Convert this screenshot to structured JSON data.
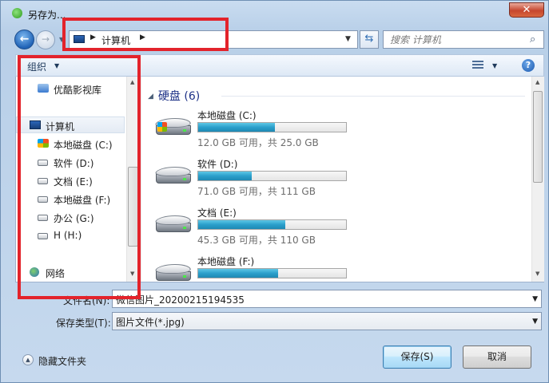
{
  "window": {
    "title": "另存为..."
  },
  "nav": {
    "breadcrumb": "计算机",
    "search_placeholder": "搜索 计算机"
  },
  "toolbar": {
    "organize": "组织"
  },
  "navpane": {
    "items": [
      {
        "label": "优酷影视库",
        "icon": "folder-icon"
      },
      {
        "label": "计算机",
        "icon": "computer-icon"
      },
      {
        "label": "本地磁盘 (C:)",
        "icon": "windows-drive-icon"
      },
      {
        "label": "软件 (D:)",
        "icon": "drive-icon"
      },
      {
        "label": "文档 (E:)",
        "icon": "drive-icon"
      },
      {
        "label": "本地磁盘 (F:)",
        "icon": "drive-icon"
      },
      {
        "label": "办公 (G:)",
        "icon": "drive-icon"
      },
      {
        "label": "H (H:)",
        "icon": "drive-icon"
      },
      {
        "label": "网络",
        "icon": "network-icon"
      }
    ]
  },
  "main": {
    "group_title": "硬盘 (6)",
    "drives": [
      {
        "name": "本地磁盘 (C:)",
        "info": "12.0 GB 可用，共 25.0 GB",
        "used_fraction": 0.52
      },
      {
        "name": "软件 (D:)",
        "info": "71.0 GB 可用，共 111 GB",
        "used_fraction": 0.36
      },
      {
        "name": "文档 (E:)",
        "info": "45.3 GB 可用，共 110 GB",
        "used_fraction": 0.59
      },
      {
        "name": "本地磁盘 (F:)",
        "info": "",
        "used_fraction": 0.54
      }
    ]
  },
  "form": {
    "filename_label": "文件名(N):",
    "filename_value": "微信图片_20200215194535",
    "filetype_label": "保存类型(T):",
    "filetype_value": "图片文件(*.jpg)"
  },
  "footer": {
    "hide_folders": "隐藏文件夹",
    "save": "保存(S)",
    "cancel": "取消"
  },
  "colors": {
    "annotation_red": "#e3232b",
    "bar_fill": "#2b9fcb"
  }
}
